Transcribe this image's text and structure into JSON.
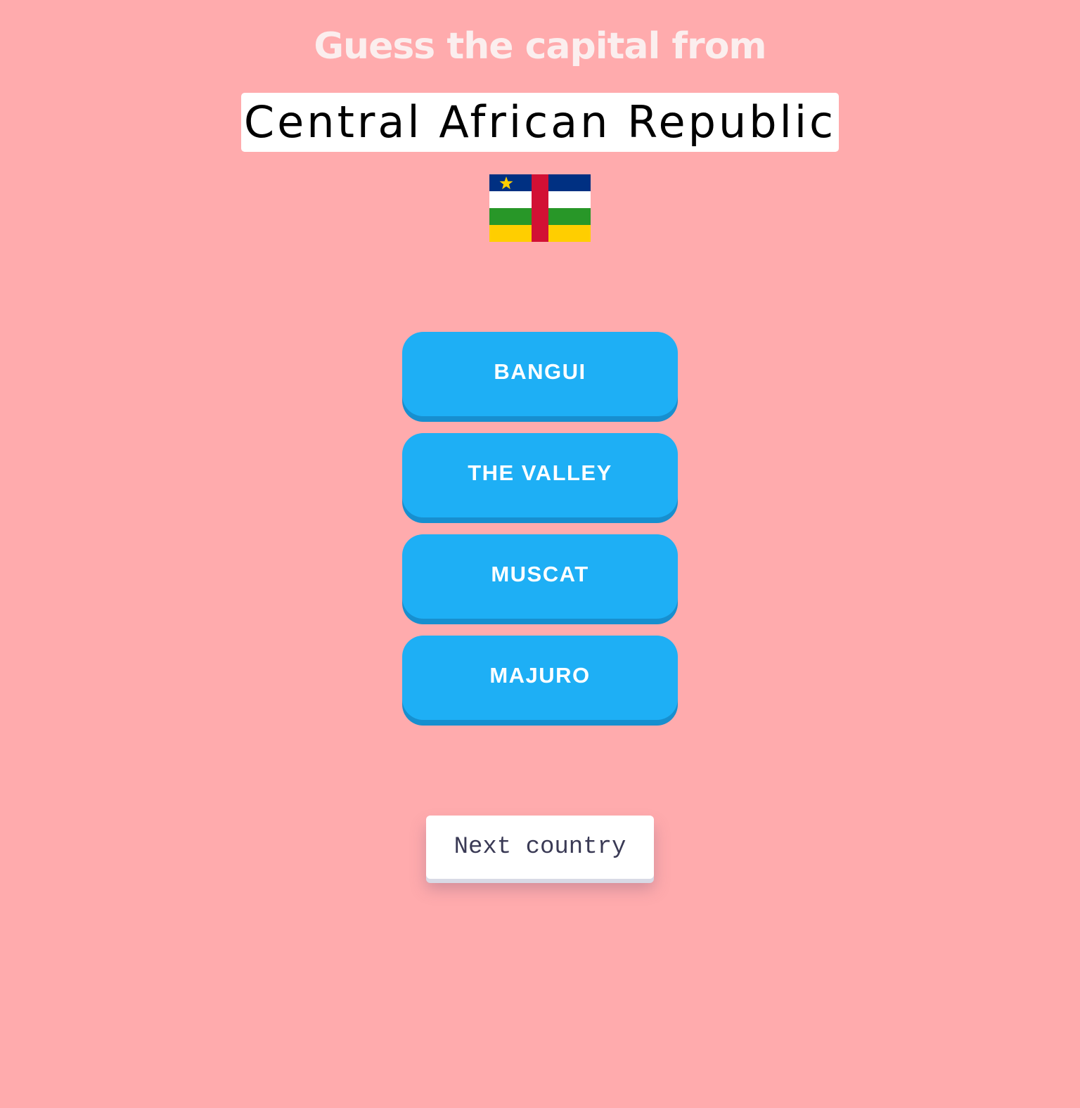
{
  "quiz": {
    "heading": "Guess the capital from",
    "country": "Central African Republic",
    "flag_icon": "central-african-republic-flag",
    "options": [
      "BANGUI",
      "THE VALLEY",
      "MUSCAT",
      "MAJURO"
    ],
    "next_label": "Next country"
  },
  "colors": {
    "background": "#ffabad",
    "option_button": "#1eaff5",
    "option_shadow": "#178fcf",
    "heading_text": "#fbeeee"
  }
}
